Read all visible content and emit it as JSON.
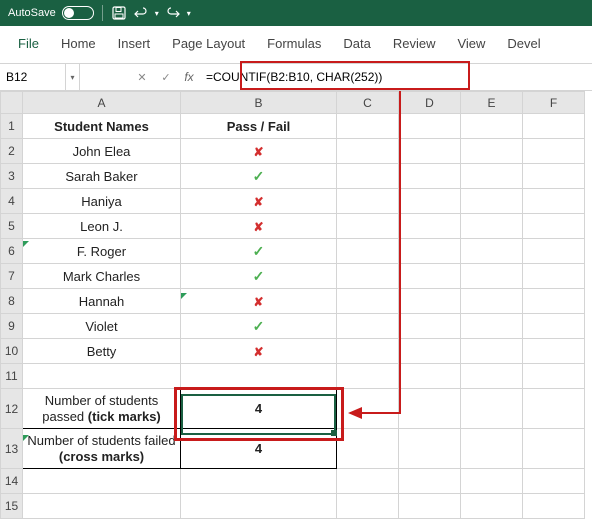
{
  "titlebar": {
    "autosave": "AutoSave",
    "toggle_state": "Off"
  },
  "ribbon": {
    "tabs": [
      "File",
      "Home",
      "Insert",
      "Page Layout",
      "Formulas",
      "Data",
      "Review",
      "View",
      "Devel"
    ]
  },
  "namebox": "B12",
  "formula": "=COUNTIF(B2:B10, CHAR(252))",
  "columns": [
    "A",
    "B",
    "C",
    "D",
    "E",
    "F"
  ],
  "rows": [
    "1",
    "2",
    "3",
    "4",
    "5",
    "6",
    "7",
    "8",
    "9",
    "10",
    "11",
    "12",
    "13",
    "14",
    "15"
  ],
  "headers": {
    "a": "Student Names",
    "b": "Pass / Fail"
  },
  "students": [
    {
      "name": "John Elea",
      "pass": false
    },
    {
      "name": "Sarah Baker",
      "pass": true
    },
    {
      "name": "Haniya",
      "pass": false
    },
    {
      "name": "Leon J.",
      "pass": false
    },
    {
      "name": "F. Roger",
      "pass": true
    },
    {
      "name": "Mark Charles",
      "pass": true
    },
    {
      "name": "Hannah",
      "pass": false
    },
    {
      "name": "Violet",
      "pass": true
    },
    {
      "name": "Betty",
      "pass": false
    }
  ],
  "summary": {
    "passed_label_pre": "Number of students passed ",
    "passed_label_bold": "(tick marks)",
    "passed_value": "4",
    "failed_label_pre": "Number of students failed ",
    "failed_label_bold": "(cross marks)",
    "failed_value": "4"
  }
}
